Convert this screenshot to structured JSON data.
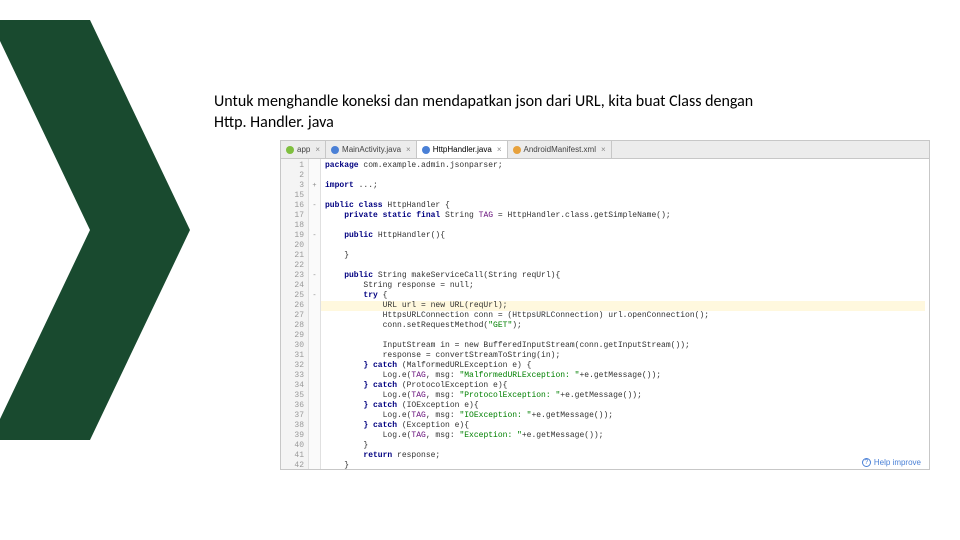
{
  "heading": {
    "line1": "Untuk menghandle koneksi dan mendapatkan json dari URL, kita buat Class dengan",
    "line2": "Http. Handler. java"
  },
  "tabs": [
    {
      "label": "app",
      "icon": "c-green",
      "active": false
    },
    {
      "label": "MainActivity.java",
      "icon": "c-blue",
      "active": false
    },
    {
      "label": "HttpHandler.java",
      "icon": "c-blue",
      "active": true
    },
    {
      "label": "AndroidManifest.xml",
      "icon": "c-orange",
      "active": false
    }
  ],
  "line_numbers": [
    "1",
    "2",
    "3",
    "15",
    "16",
    "17",
    "18",
    "19",
    "20",
    "21",
    "22",
    "23",
    "24",
    "25",
    "26",
    "27",
    "28",
    "29",
    "30",
    "31",
    "32",
    "33",
    "34",
    "35",
    "36",
    "37",
    "38",
    "39",
    "40",
    "41",
    "42"
  ],
  "fold_marks": {
    "0": "",
    "1": "",
    "2": "+",
    "3": "",
    "4": "-",
    "5": "",
    "6": "",
    "7": "-",
    "8": "",
    "9": "",
    "10": "",
    "11": "-",
    "12": "",
    "13": "-",
    "14": "",
    "15": "",
    "16": "",
    "17": "",
    "18": "",
    "19": "",
    "20": "",
    "21": "",
    "22": "",
    "23": "",
    "24": "",
    "25": "",
    "26": "",
    "27": "",
    "28": "",
    "29": "",
    "30": ""
  },
  "code": {
    "l0": {
      "pre": "",
      "kw": "package ",
      "rest": "com.example.admin.jsonparser;"
    },
    "l1": {
      "pre": "",
      "kw": "",
      "rest": ""
    },
    "l2": {
      "pre": "",
      "kw": "import ",
      "rest": "...;"
    },
    "l3": {
      "pre": "",
      "kw": "",
      "rest": ""
    },
    "l4": {
      "pre": "",
      "kw": "public class ",
      "rest": "HttpHandler {"
    },
    "l5": {
      "pre": "    ",
      "kw": "private static final ",
      "rest": "String TAG = HttpHandler.class.getSimpleName();"
    },
    "l6": {
      "pre": "",
      "kw": "",
      "rest": ""
    },
    "l7": {
      "pre": "    ",
      "kw": "public ",
      "rest": "HttpHandler(){"
    },
    "l8": {
      "pre": "",
      "kw": "",
      "rest": ""
    },
    "l9": {
      "pre": "    ",
      "kw": "",
      "rest": "}"
    },
    "l10": {
      "pre": "",
      "kw": "",
      "rest": ""
    },
    "l11": {
      "pre": "    ",
      "kw": "public ",
      "rest": "String makeServiceCall(String reqUrl){"
    },
    "l12": {
      "pre": "        ",
      "kw": "",
      "rest": "String response = null;"
    },
    "l13": {
      "pre": "        ",
      "kw": "try ",
      "rest": "{"
    },
    "l14": {
      "pre": "            ",
      "kw": "",
      "rest": "URL url = new URL(reqUrl);"
    },
    "l15": {
      "pre": "            ",
      "kw": "",
      "rest": "HttpsURLConnection conn = (HttpsURLConnection) url.openConnection();"
    },
    "l16": {
      "pre": "            ",
      "kw": "",
      "rest": "conn.setRequestMethod(\"GET\");"
    },
    "l17": {
      "pre": "",
      "kw": "",
      "rest": ""
    },
    "l18": {
      "pre": "            ",
      "kw": "",
      "rest": "InputStream in = new BufferedInputStream(conn.getInputStream());"
    },
    "l19": {
      "pre": "            ",
      "kw": "",
      "rest": "response = convertStreamToString(in);"
    },
    "l20": {
      "pre": "        ",
      "kw": "} catch ",
      "rest": "(MalformedURLException e) {"
    },
    "l21": {
      "pre": "            ",
      "kw": "",
      "rest": "Log.e(TAG, msg: \"MalformedURLException: \"+e.getMessage());"
    },
    "l22": {
      "pre": "        ",
      "kw": "} catch ",
      "rest": "(ProtocolException e){"
    },
    "l23": {
      "pre": "            ",
      "kw": "",
      "rest": "Log.e(TAG, msg: \"ProtocolException: \"+e.getMessage());"
    },
    "l24": {
      "pre": "        ",
      "kw": "} catch ",
      "rest": "(IOException e){"
    },
    "l25": {
      "pre": "            ",
      "kw": "",
      "rest": "Log.e(TAG, msg: \"IOException: \"+e.getMessage());"
    },
    "l26": {
      "pre": "        ",
      "kw": "} catch ",
      "rest": "(Exception e){"
    },
    "l27": {
      "pre": "            ",
      "kw": "",
      "rest": "Log.e(TAG, msg: \"Exception: \"+e.getMessage());"
    },
    "l28": {
      "pre": "        ",
      "kw": "",
      "rest": "}"
    },
    "l29": {
      "pre": "        ",
      "kw": "return ",
      "rest": "response;"
    },
    "l30": {
      "pre": "    ",
      "kw": "",
      "rest": "}"
    }
  },
  "help_text": "Help improve"
}
